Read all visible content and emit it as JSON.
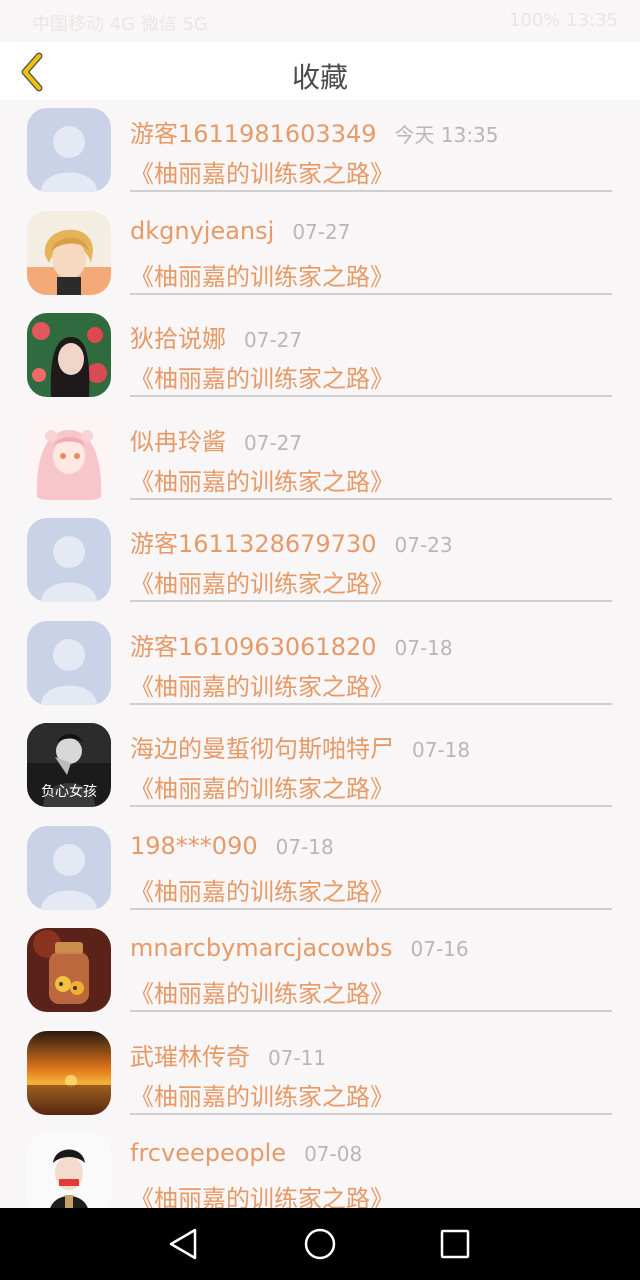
{
  "status_bar": {
    "left_text": "中国移动 4G 微信 5G",
    "right_text": "100% 13:35"
  },
  "header": {
    "title": "收藏",
    "back_icon": "chevron-left-icon",
    "accent_color": "#f2c200"
  },
  "favorites": [
    {
      "username": "游客1611981603349",
      "time": "今天 13:35",
      "book": "《柚丽嘉的训练家之路》",
      "avatar": "default-avatar"
    },
    {
      "username": "dkgnyjeansj",
      "time": "07-27",
      "book": "《柚丽嘉的训练家之路》",
      "avatar": "anime-boy-avatar"
    },
    {
      "username": "狄拾说娜",
      "time": "07-27",
      "book": "《柚丽嘉的训练家之路》",
      "avatar": "girl-flowers-avatar"
    },
    {
      "username": "似冉玲酱",
      "time": "07-27",
      "book": "《柚丽嘉的训练家之路》",
      "avatar": "anime-girl-avatar"
    },
    {
      "username": "游客1611328679730",
      "time": "07-23",
      "book": "《柚丽嘉的训练家之路》",
      "avatar": "default-avatar"
    },
    {
      "username": "游客1610963061820",
      "time": "07-18",
      "book": "《柚丽嘉的训练家之路》",
      "avatar": "default-avatar"
    },
    {
      "username": "海边的曼蜇彻句斯啪特尸",
      "time": "07-18",
      "book": "《柚丽嘉的训练家之路》",
      "avatar": "dark-portrait-avatar",
      "avatar_text": "负心女孩"
    },
    {
      "username": "198***090",
      "time": "07-18",
      "book": "《柚丽嘉的训练家之路》",
      "avatar": "default-avatar"
    },
    {
      "username": "mnarcbymarcjacowbs",
      "time": "07-16",
      "book": "《柚丽嘉的训练家之路》",
      "avatar": "jar-avatar"
    },
    {
      "username": "武璀林传奇",
      "time": "07-11",
      "book": "《柚丽嘉的训练家之路》",
      "avatar": "sunset-avatar"
    },
    {
      "username": "frcveepeople",
      "time": "07-08",
      "book": "《柚丽嘉的训练家之路》",
      "avatar": "hooded-boy-avatar"
    }
  ],
  "nav": {
    "back": "triangle-back-icon",
    "home": "circle-home-icon",
    "recent": "square-recent-icon"
  },
  "colors": {
    "name": "#e79a67",
    "time": "#b7b7b7",
    "divider": "#cfcfcf",
    "background": "#f8f6f6"
  }
}
